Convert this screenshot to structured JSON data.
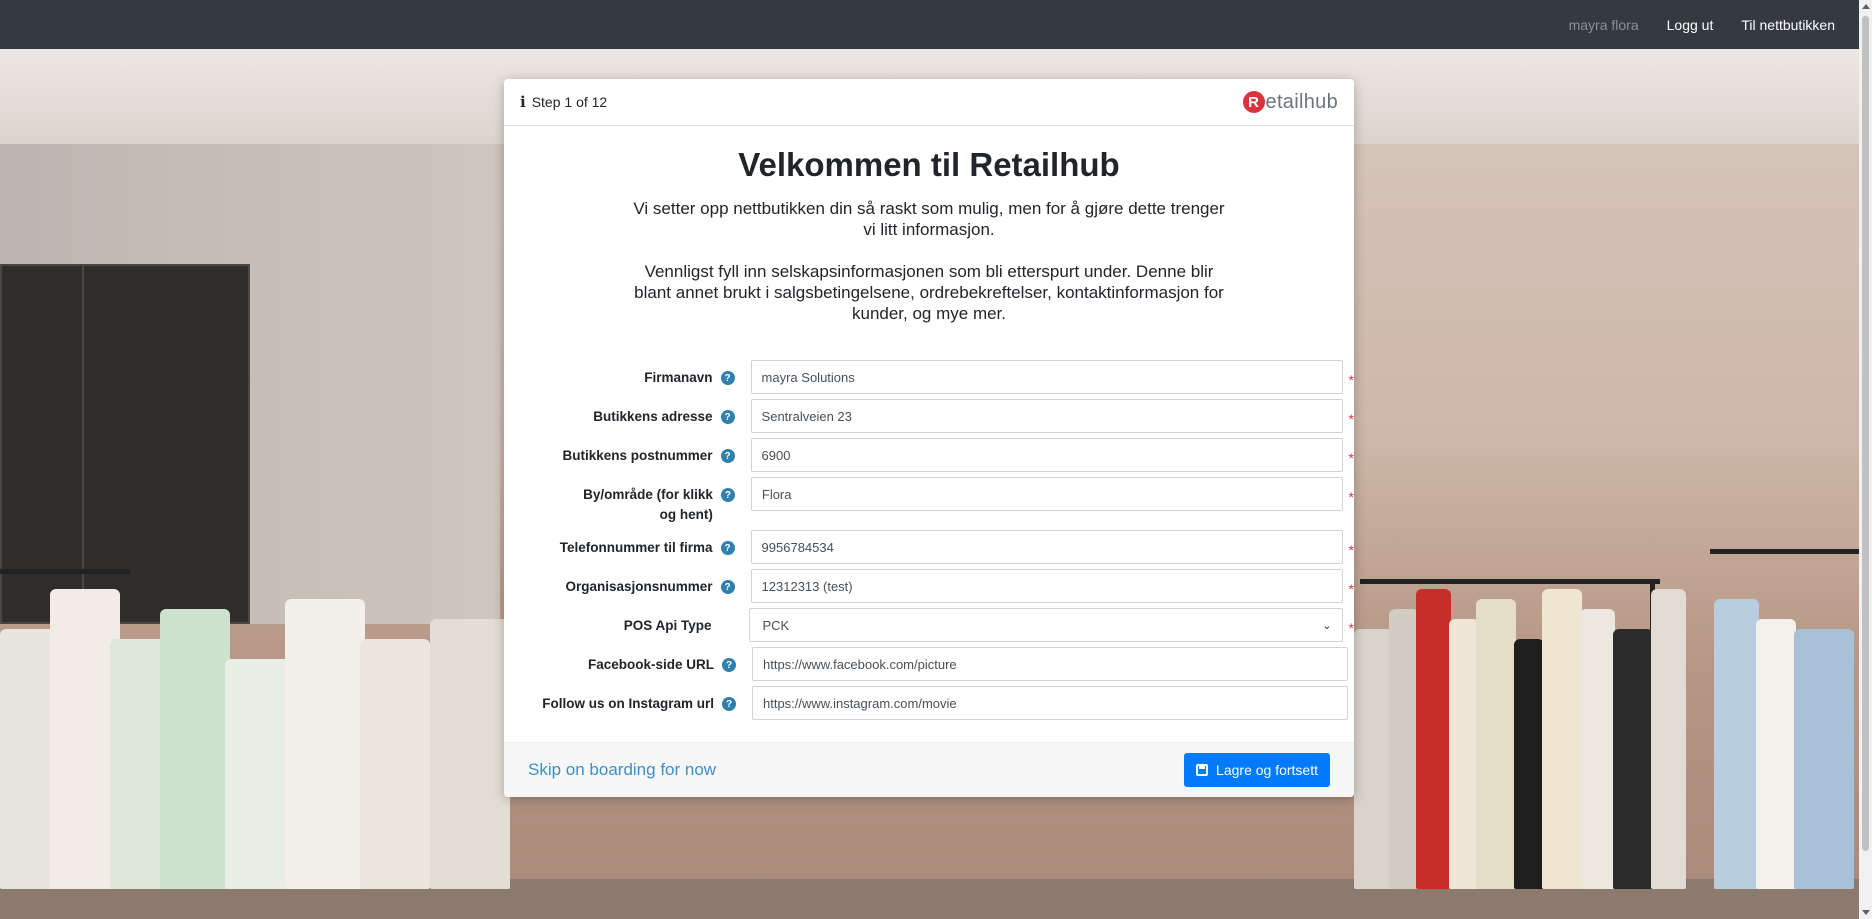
{
  "navbar": {
    "user": "mayra flora",
    "logout": "Logg ut",
    "to_store": "Til nettbutikken"
  },
  "modal": {
    "step": "Step 1 of 12",
    "logo_text": "etailhub",
    "logo_mark": "R",
    "title": "Velkommen til Retailhub",
    "intro_1": "Vi setter opp nettbutikken din så raskt som mulig, men for å gjøre dette trenger vi litt informasjon.",
    "intro_2": "Vennligst fyll inn selskapsinformasjonen som bli etterspurt under. Denne blir blant annet brukt i salgsbetingelsene, ordrebekreftelser, kontaktinformasjon for kunder, og mye mer."
  },
  "form": {
    "company_name": {
      "label": "Firmanavn",
      "value": "mayra Solutions",
      "required": "*"
    },
    "store_address": {
      "label": "Butikkens adresse",
      "value": "Sentralveien 23",
      "required": "*"
    },
    "store_zip": {
      "label": "Butikkens postnummer",
      "value": "6900",
      "required": "*"
    },
    "city": {
      "label": "By/område (for klikk og hent)",
      "value": "Flora",
      "required": "*"
    },
    "phone": {
      "label": "Telefonnummer til firma",
      "value": "9956784534",
      "required": "*"
    },
    "org_number": {
      "label": "Organisasjonsnummer",
      "value": "12312313 (test)",
      "required": "*"
    },
    "pos_api_type": {
      "label": "POS Api Type",
      "value": "PCK",
      "required": "*"
    },
    "facebook_url": {
      "label": "Facebook-side URL",
      "value": "https://www.facebook.com/picture"
    },
    "instagram_url": {
      "label": "Follow us on Instagram url",
      "value": "https://www.instagram.com/movie"
    },
    "help_glyph": "?"
  },
  "footer": {
    "skip": "Skip on boarding for now",
    "save": "Lagre og fortsett"
  },
  "colors": {
    "navbar": "#343a40",
    "primary": "#007bff",
    "link": "#3d8fc6",
    "required": "#dc3545",
    "help_icon": "#2f80ad",
    "logo_red": "#d9333f"
  },
  "icons": {
    "step": "info-icon",
    "help": "question-circle-icon",
    "save": "floppy-disk-icon",
    "select": "chevron-down-icon"
  }
}
